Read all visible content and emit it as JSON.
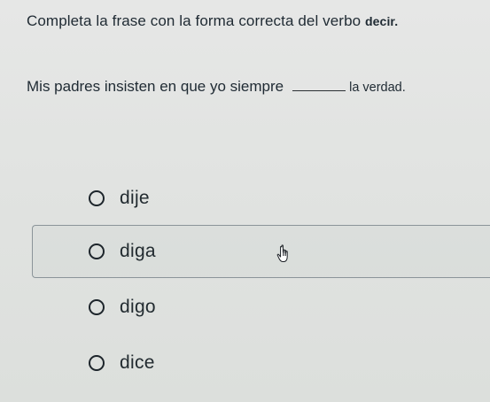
{
  "question": {
    "prompt": "Completa la frase con la forma correcta del verbo",
    "verb": "decir."
  },
  "sentence": {
    "before": "Mis padres insisten en que yo siempre",
    "after": "la verdad."
  },
  "options": [
    {
      "label": "dije",
      "selected": false,
      "hovered": false
    },
    {
      "label": "diga",
      "selected": false,
      "hovered": true
    },
    {
      "label": "digo",
      "selected": false,
      "hovered": false
    },
    {
      "label": "dice",
      "selected": false,
      "hovered": false
    }
  ],
  "icons": {
    "cursor": "hand-pointer-icon",
    "radio": "radio-unchecked-icon"
  }
}
